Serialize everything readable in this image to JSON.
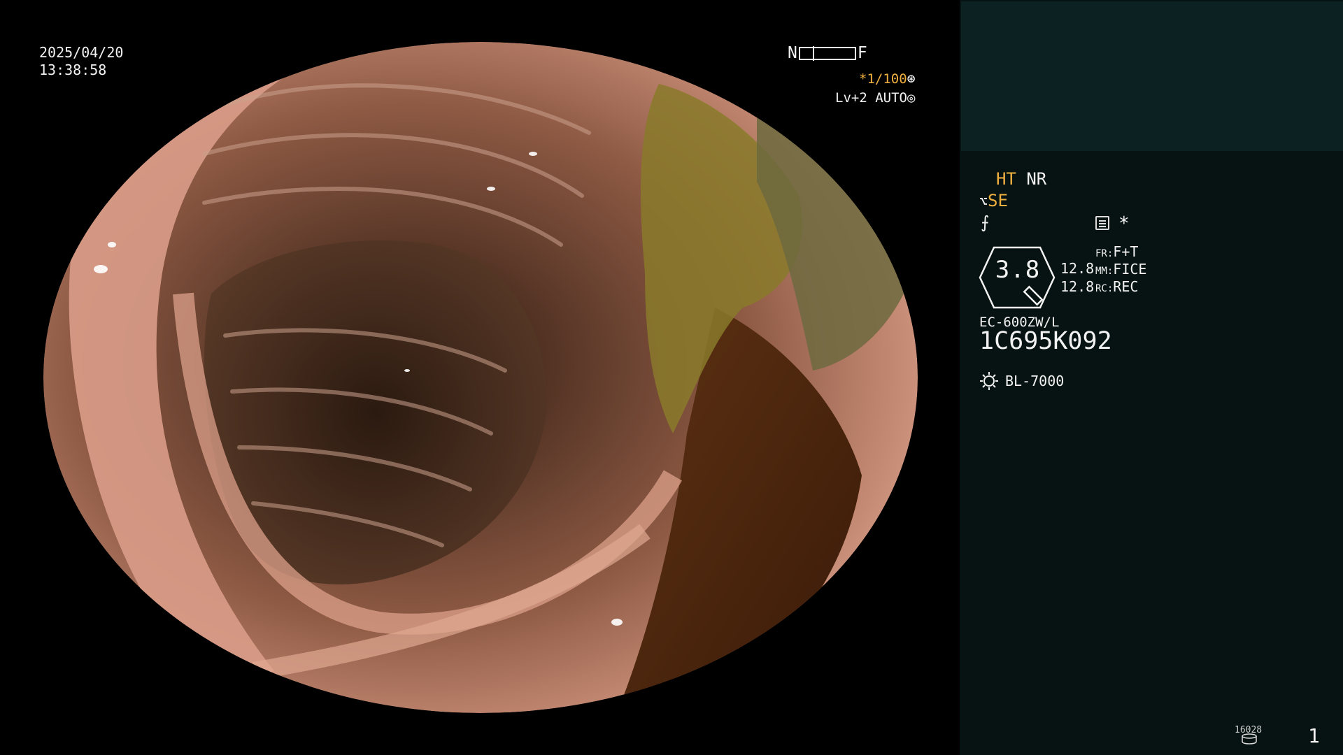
{
  "osd": {
    "date": "2025/04/20",
    "time": "13:38:58",
    "nf_near": "N",
    "nf_far": "F",
    "shutter": "*1/100",
    "level": "Lv+2 AUTO"
  },
  "panel": {
    "ht": "HT",
    "nr": "NR",
    "se": "SE",
    "zoom": "3.8",
    "mag_top": "12.8",
    "mag_bottom": "12.8",
    "fr_label": "FR:",
    "fr_value": "F+T",
    "mm_label": "MM:",
    "mm_value": "FICE",
    "rc_label": "RC:",
    "rc_value": "REC",
    "scope_model": "EC-600ZW/L",
    "scope_serial": "1C695K092",
    "light_source": "BL-7000",
    "storage_count": "16028",
    "page_number": "1"
  },
  "icons": {
    "star": "*",
    "shutter_symbol": "aperture-icon",
    "level_symbol": "iris-icon",
    "tool": "tool-icon",
    "freeze": "freeze-icon",
    "menu": "menu-icon",
    "light": "lamp-icon",
    "disk": "disk-icon"
  },
  "colors": {
    "amber": "#f0b040",
    "panel_bg": "#061312",
    "panel_top": "#0c2222"
  }
}
